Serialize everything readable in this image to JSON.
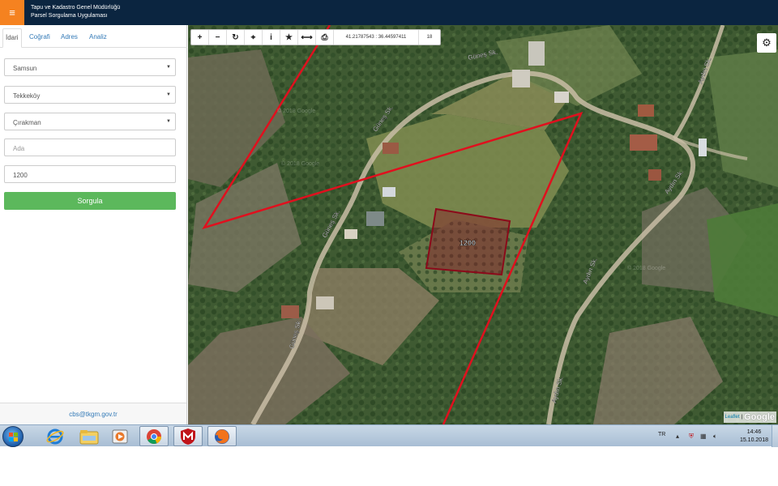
{
  "header": {
    "title_line1": "Tapu ve Kadastro Genel Müdürlüğü",
    "title_line2": "Parsel Sorgulama Uygulaması",
    "menu_icon": "hamburger-icon"
  },
  "sidebar": {
    "tabs": [
      {
        "label": "İdari",
        "active": true
      },
      {
        "label": "Coğrafi",
        "active": false
      },
      {
        "label": "Adres",
        "active": false
      },
      {
        "label": "Analiz",
        "active": false
      }
    ],
    "province": "Samsun",
    "district": "Tekkeköy",
    "neighborhood": "Çırakman",
    "block_placeholder": "Ada",
    "block_value": "",
    "parcel_value": "1200",
    "query_button": "Sorgula",
    "footer_email": "cbs@tkgm.gov.tr"
  },
  "map": {
    "toolbar_icons": [
      "zoom-in-icon",
      "zoom-out-icon",
      "refresh-icon",
      "locate-icon",
      "info-icon",
      "star-icon",
      "measure-icon",
      "print-icon"
    ],
    "coordinates": "41.21787543 : 36.44597411",
    "zoom": "18",
    "parcel_label": "1200",
    "street_labels": [
      "Güneş Sk.",
      "Güneş Sk.",
      "Güneş Sk.",
      "Güneş Sk.",
      "Aydın Sk.",
      "Aydın Sk.",
      "Aydın Sk.",
      "Aydın Sk."
    ],
    "watermarks": [
      "© 2018 Google",
      "© 2018 Google",
      "© 2018 Google"
    ],
    "attribution_leaflet": "Leaflet",
    "attribution_separator": "|",
    "attribution_google": "Google",
    "colors": {
      "parcel_stroke": "#8b0a1a",
      "parcel_fill": "#8b1a28",
      "line_red": "#e0101e"
    }
  },
  "taskbar": {
    "apps": [
      "internet-explorer-icon",
      "file-explorer-icon",
      "media-player-icon",
      "chrome-icon",
      "mcafee-icon",
      "firefox-icon"
    ],
    "language": "TR",
    "time": "14:46",
    "date": "15.10.2018"
  }
}
